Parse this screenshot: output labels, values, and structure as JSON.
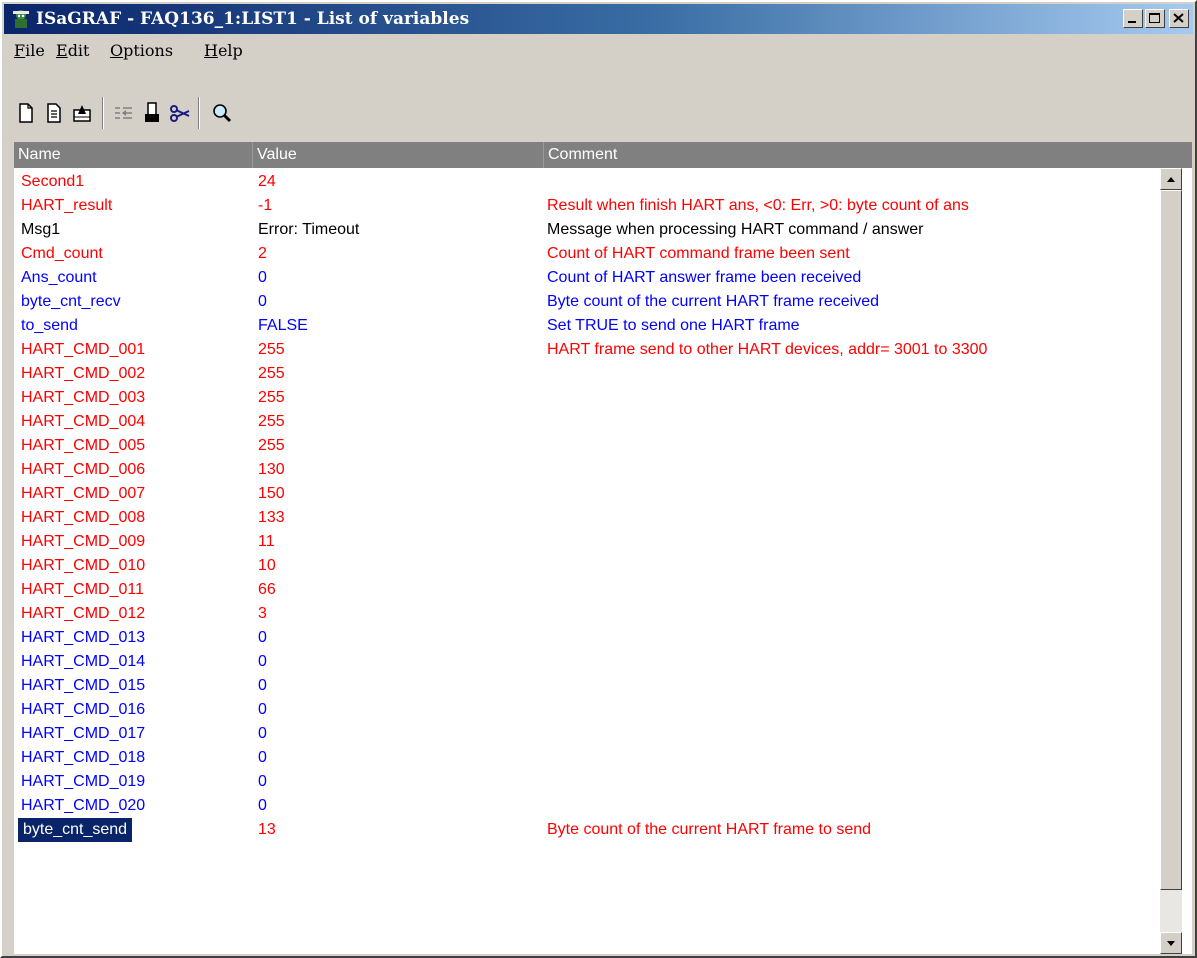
{
  "window": {
    "title": "ISaGRAF - FAQ136_1:LIST1 - List of variables"
  },
  "menu": {
    "file": "File",
    "edit": "Edit",
    "options": "Options",
    "help": "Help"
  },
  "toolbar": {
    "icons": [
      "new-icon",
      "properties-icon",
      "open-icon",
      "move-icon",
      "paste-icon",
      "cut-icon",
      "search-icon"
    ]
  },
  "list": {
    "columns": {
      "name": "Name",
      "value": "Value",
      "comment": "Comment"
    },
    "colors": {
      "red": "#ff0000",
      "blue": "#0000ff",
      "black": "#000000",
      "selection": "#0a246a"
    },
    "rows": [
      {
        "name": "Second1",
        "value": "24",
        "comment": "",
        "color": "red"
      },
      {
        "name": "HART_result",
        "value": "-1",
        "comment": "Result when finish HART ans, <0: Err, >0: byte count of ans",
        "color": "red"
      },
      {
        "name": "Msg1",
        "value": "Error: Timeout",
        "comment": "Message when processing HART command / answer",
        "color": "black"
      },
      {
        "name": "Cmd_count",
        "value": "2",
        "comment": "Count of HART command frame been sent",
        "color": "red"
      },
      {
        "name": "Ans_count",
        "value": "0",
        "comment": "Count of HART answer frame been received",
        "color": "blue"
      },
      {
        "name": "byte_cnt_recv",
        "value": "0",
        "comment": "Byte count of the current HART frame received",
        "color": "blue"
      },
      {
        "name": "to_send",
        "value": "FALSE",
        "comment": "Set TRUE to send one HART frame",
        "color": "blue"
      },
      {
        "name": "HART_CMD_001",
        "value": "255",
        "comment": "HART frame send to other HART devices, addr= 3001 to 3300",
        "color": "red"
      },
      {
        "name": "HART_CMD_002",
        "value": "255",
        "comment": "",
        "color": "red"
      },
      {
        "name": "HART_CMD_003",
        "value": "255",
        "comment": "",
        "color": "red"
      },
      {
        "name": "HART_CMD_004",
        "value": "255",
        "comment": "",
        "color": "red"
      },
      {
        "name": "HART_CMD_005",
        "value": "255",
        "comment": "",
        "color": "red"
      },
      {
        "name": "HART_CMD_006",
        "value": "130",
        "comment": "",
        "color": "red"
      },
      {
        "name": "HART_CMD_007",
        "value": "150",
        "comment": "",
        "color": "red"
      },
      {
        "name": "HART_CMD_008",
        "value": "133",
        "comment": "",
        "color": "red"
      },
      {
        "name": "HART_CMD_009",
        "value": "11",
        "comment": "",
        "color": "red"
      },
      {
        "name": "HART_CMD_010",
        "value": "10",
        "comment": "",
        "color": "red"
      },
      {
        "name": "HART_CMD_011",
        "value": "66",
        "comment": "",
        "color": "red"
      },
      {
        "name": "HART_CMD_012",
        "value": "3",
        "comment": "",
        "color": "red"
      },
      {
        "name": "HART_CMD_013",
        "value": "0",
        "comment": "",
        "color": "blue"
      },
      {
        "name": "HART_CMD_014",
        "value": "0",
        "comment": "",
        "color": "blue"
      },
      {
        "name": "HART_CMD_015",
        "value": "0",
        "comment": "",
        "color": "blue"
      },
      {
        "name": "HART_CMD_016",
        "value": "0",
        "comment": "",
        "color": "blue"
      },
      {
        "name": "HART_CMD_017",
        "value": "0",
        "comment": "",
        "color": "blue"
      },
      {
        "name": "HART_CMD_018",
        "value": "0",
        "comment": "",
        "color": "blue"
      },
      {
        "name": "HART_CMD_019",
        "value": "0",
        "comment": "",
        "color": "blue"
      },
      {
        "name": "HART_CMD_020",
        "value": "0",
        "comment": "",
        "color": "blue"
      },
      {
        "name": "byte_cnt_send",
        "value": "13",
        "comment": "Byte count of the current HART frame to send",
        "color": "red",
        "selected": true
      }
    ]
  }
}
